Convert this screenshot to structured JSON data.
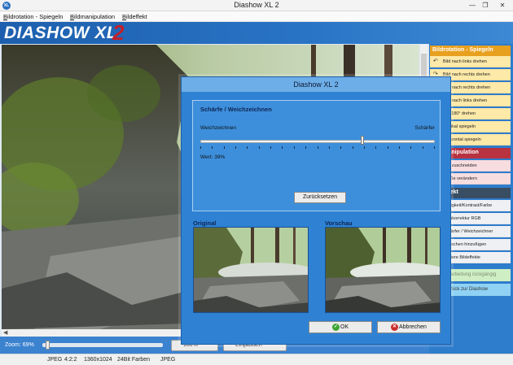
{
  "window": {
    "app_icon": "XL",
    "title": "Diashow XL 2",
    "min_glyph": "—",
    "max_glyph": "❐",
    "close_glyph": "✕"
  },
  "menu": {
    "items": [
      {
        "underline": "B",
        "rest": "ildrotation - Spiegeln"
      },
      {
        "underline": "B",
        "rest": "ildmanipulation"
      },
      {
        "underline": "B",
        "rest": "ildeffekt"
      }
    ]
  },
  "banner": {
    "logo_text": "DIASHOW XL",
    "logo_num": "2"
  },
  "bottombar": {
    "zoom_label": "Zoom: 69%",
    "zoom_value_percent": 69,
    "btn_100_label": "100%",
    "btn_fit_label": "Einpassen"
  },
  "statusbar": {
    "items": [
      "JPEG",
      "4:2:2",
      "1360x1024",
      "24Bit Farben",
      "JPEG"
    ]
  },
  "rightpanel": {
    "rotation_head": "Bildrotation - Spiegeln",
    "rotation_items": [
      "Bild nach links drehen",
      "Bild nach rechts drehen",
      "Frei nach rechts drehen",
      "Frei nach links drehen",
      "Um 180° drehen",
      "Vertikal spiegeln",
      "Horizontal spiegeln"
    ],
    "manip_head": "Bildmanipulation",
    "manip_items": [
      "Bild zuschneiden",
      "Größe verändern"
    ],
    "effect_head": "Bildeffekt",
    "effect_items": [
      "Helligkeit/Kontrast/Farbe",
      "Farbkorrektur RGB",
      "Schärfer / Weichzeichner",
      "Rauschen hinzufügen",
      "Weitere Bildeffekte"
    ],
    "undo_label": "Bearbeitung rückgängig",
    "back_label": "Zurück zur Diashow"
  },
  "dialog": {
    "title": "Diashow XL 2",
    "group_title": "Schärfe / Weichzeichnen",
    "label_soft": "Weichzeichnen",
    "label_sharp": "Schärfer",
    "value_text": "Wert: 39%",
    "sharpness_fraction": 0.69,
    "reset_label": "Zurücksetzen",
    "original_label": "Original",
    "preview_label": "Vorschau",
    "ok_label": "OK",
    "cancel_label": "Abbrechen"
  },
  "colors": {
    "accent": "#2e7ccc",
    "rotation_head": "#e8a01f",
    "manip_head": "#b8323f",
    "effect_head": "#3a4e63"
  }
}
